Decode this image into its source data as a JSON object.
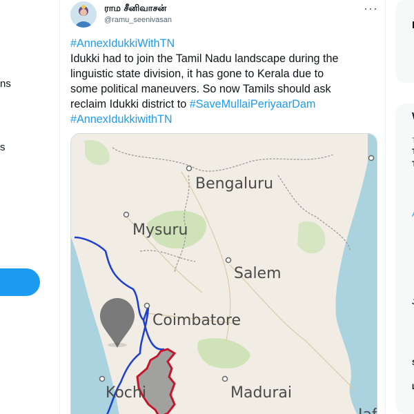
{
  "nav": {
    "frag1": "ns",
    "frag2": "s"
  },
  "tweet": {
    "display_name": "ராம சீனிவாசன்",
    "handle": "@ramu_seenivasan",
    "more": "···",
    "line1_hashtag": "#AnnexIdukkiWithTN",
    "line2": "Idukki had to join the Tamil Nadu landscape during the",
    "line3": "linguistic state division, it has gone to Kerala due to",
    "line4": "some political maneuvers. So now Tamils should ask",
    "line5_text": "reclaim Idukki district to ",
    "line5_hashtag": "#SaveMullaiPeriyaarDam",
    "line6_hashtag": "#AnnexIdukkiwithTN"
  },
  "map": {
    "cities": {
      "bengaluru": "Bengaluru",
      "mysuru": "Mysuru",
      "salem": "Salem",
      "coimbatore": "Coimbatore",
      "kochi": "Kochi",
      "madurai": "Madurai",
      "jaffna": "Jaf"
    },
    "colors": {
      "land": "#f1ede4",
      "sea": "#aad3df",
      "forest": "#cfe2b8",
      "state_border_blue": "#1f3fd1",
      "idukki_border": "#c4162a",
      "idukki_fill": "#8d8d8d",
      "pin": "#7a7a7a"
    }
  },
  "right_panel": {
    "w": "W",
    "t": "T",
    "a": "A",
    "j": "J",
    "s": "S",
    "l": "L"
  },
  "colors": {
    "accent": "#1d9bf0",
    "text": "#0f1419",
    "muted": "#536471"
  }
}
